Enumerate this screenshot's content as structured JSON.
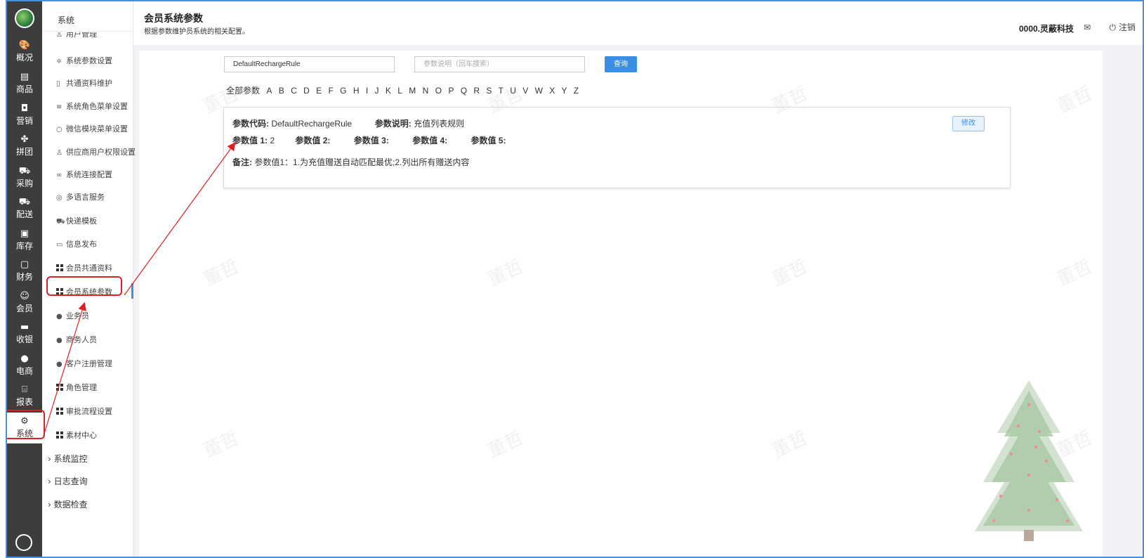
{
  "nav": {
    "items": [
      {
        "label": "概况",
        "icon": "palette-icon"
      },
      {
        "label": "商品",
        "icon": "document-icon"
      },
      {
        "label": "营销",
        "icon": "bag-icon"
      },
      {
        "label": "拼团",
        "icon": "clover-icon"
      },
      {
        "label": "采购",
        "icon": "cart-icon"
      },
      {
        "label": "配送",
        "icon": "truck-icon"
      },
      {
        "label": "库存",
        "icon": "box-icon"
      },
      {
        "label": "财务",
        "icon": "finance-icon"
      },
      {
        "label": "会员",
        "icon": "user-icon"
      },
      {
        "label": "收银",
        "icon": "cashier-icon"
      },
      {
        "label": "电商",
        "icon": "person-icon"
      },
      {
        "label": "报表",
        "icon": "report-icon"
      },
      {
        "label": "系统",
        "icon": "gear-icon"
      }
    ]
  },
  "submenu": {
    "title": "系统",
    "items": [
      {
        "label": "用户管理",
        "icon": "user-icon"
      },
      {
        "label": "系统参数设置",
        "icon": "sliders-icon"
      },
      {
        "label": "共通资料维护",
        "icon": "doc-icon"
      },
      {
        "label": "系统角色菜单设置",
        "icon": "list-icon"
      },
      {
        "label": "微信模块菜单设置",
        "icon": "chat-icon"
      },
      {
        "label": "供应商用户权限设置",
        "icon": "user-icon"
      },
      {
        "label": "系统连接配置",
        "icon": "link-icon"
      },
      {
        "label": "多语言服务",
        "icon": "globe-icon"
      },
      {
        "label": "快递模板",
        "icon": "truck-icon"
      },
      {
        "label": "信息发布",
        "icon": "message-icon"
      },
      {
        "label": "会员共通资料",
        "icon": "grid-icon"
      },
      {
        "label": "会员系统参数",
        "icon": "grid-icon"
      },
      {
        "label": "业务员",
        "icon": "person-icon"
      },
      {
        "label": "商务人员",
        "icon": "person-icon"
      },
      {
        "label": "客户注册管理",
        "icon": "people-icon"
      },
      {
        "label": "角色管理",
        "icon": "grid-icon"
      },
      {
        "label": "审批流程设置",
        "icon": "grid-icon"
      },
      {
        "label": "素材中心",
        "icon": "grid-icon"
      }
    ],
    "groups": [
      "系统监控",
      "日志查询",
      "数据检查"
    ]
  },
  "header": {
    "title": "会员系统参数",
    "subtitle": "根据参数维护员系统的相关配置。",
    "company": "0000.灵蔽科技",
    "logout": "注销"
  },
  "search": {
    "code_value": "DefaultRechargeRule",
    "desc_placeholder": "参数说明（回车搜索）",
    "query_button": "查询"
  },
  "letters": {
    "all": "全部参数",
    "list": [
      "A",
      "B",
      "C",
      "D",
      "E",
      "F",
      "G",
      "H",
      "I",
      "J",
      "K",
      "L",
      "M",
      "N",
      "O",
      "P",
      "Q",
      "R",
      "S",
      "T",
      "U",
      "V",
      "W",
      "X",
      "Y",
      "Z"
    ]
  },
  "card": {
    "code_label": "参数代码:",
    "code_value": "DefaultRechargeRule",
    "desc_label": "参数说明:",
    "desc_value": "充值列表规则",
    "value1_label": "参数值 1:",
    "value1": "2",
    "value2_label": "参数值 2:",
    "value3_label": "参数值 3:",
    "value4_label": "参数值 4:",
    "value5_label": "参数值 5:",
    "remark_label": "备注:",
    "remark_value": "参数值1：1.为充值赠送自动匹配最优;2.列出所有赠送内容",
    "edit_button": "修改"
  },
  "watermark": "董哲",
  "colors": {
    "accent": "#3a8ee6",
    "highlight": "#e02020",
    "nav_bg": "#3d3d3d"
  }
}
